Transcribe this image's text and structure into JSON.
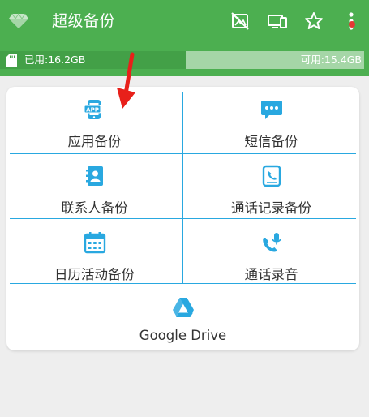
{
  "app": {
    "title": "超级备份"
  },
  "toolbar": {
    "icons": [
      "image-off-icon",
      "device-switch-icon",
      "star-icon",
      "more-vert-icon"
    ]
  },
  "storage": {
    "used_label": "已用:16.2GB",
    "free_label": "可用:15.4GB",
    "used_fraction": 0.51
  },
  "grid": {
    "items": [
      {
        "label": "应用备份",
        "icon": "app-icon"
      },
      {
        "label": "短信备份",
        "icon": "sms-icon"
      },
      {
        "label": "联系人备份",
        "icon": "contacts-icon"
      },
      {
        "label": "通话记录备份",
        "icon": "call-log-icon"
      },
      {
        "label": "日历活动备份",
        "icon": "calendar-icon"
      },
      {
        "label": "通话录音",
        "icon": "call-record-icon"
      }
    ],
    "drive": {
      "label": "Google Drive",
      "icon": "google-drive-icon"
    }
  },
  "colors": {
    "appbar": "#4caf50",
    "storage_used": "#43a047",
    "storage_free": "#a5d6a7",
    "accent_blue": "#29a8e0",
    "annotation_arrow": "#e8201a"
  }
}
